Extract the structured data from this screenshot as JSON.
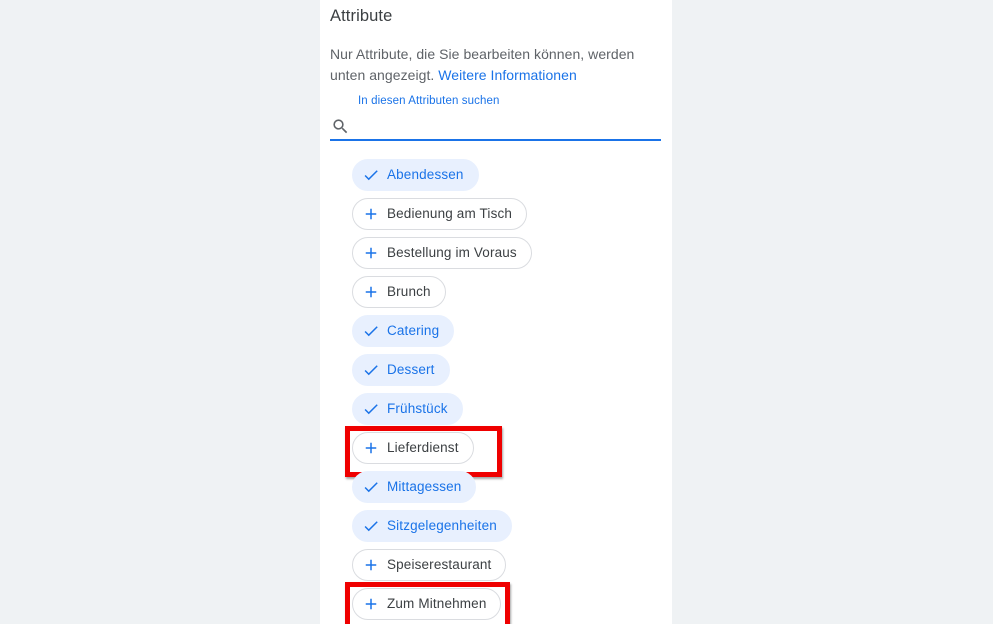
{
  "panel": {
    "title": "Attribute",
    "description_before_link": "Nur Attribute, die Sie bearbeiten können, werden unten angezeigt. ",
    "description_link": "Weitere Informationen"
  },
  "search": {
    "label": "In diesen Attributen suchen",
    "value": "",
    "placeholder": "",
    "icon": "search-icon"
  },
  "colors": {
    "accent": "#1a73e8",
    "chip_selected_bg": "#e8f0fe",
    "chip_border": "#dadce0",
    "text_primary": "#3c4043",
    "text_secondary": "#5f6368",
    "page_bg": "#eff2f4",
    "panel_bg": "#ffffff",
    "highlight": "#ef0000"
  },
  "chips": [
    {
      "label": "Abendessen",
      "selected": true,
      "icon": "check-icon",
      "highlighted": false
    },
    {
      "label": "Bedienung am Tisch",
      "selected": false,
      "icon": "plus-icon",
      "highlighted": false
    },
    {
      "label": "Bestellung im Voraus",
      "selected": false,
      "icon": "plus-icon",
      "highlighted": false
    },
    {
      "label": "Brunch",
      "selected": false,
      "icon": "plus-icon",
      "highlighted": false
    },
    {
      "label": "Catering",
      "selected": true,
      "icon": "check-icon",
      "highlighted": false
    },
    {
      "label": "Dessert",
      "selected": true,
      "icon": "check-icon",
      "highlighted": false
    },
    {
      "label": "Frühstück",
      "selected": true,
      "icon": "check-icon",
      "highlighted": false
    },
    {
      "label": "Lieferdienst",
      "selected": false,
      "icon": "plus-icon",
      "highlighted": true
    },
    {
      "label": "Mittagessen",
      "selected": true,
      "icon": "check-icon",
      "highlighted": false
    },
    {
      "label": "Sitzgelegenheiten",
      "selected": true,
      "icon": "check-icon",
      "highlighted": false
    },
    {
      "label": "Speiserestaurant",
      "selected": false,
      "icon": "plus-icon",
      "highlighted": false
    },
    {
      "label": "Zum Mitnehmen",
      "selected": false,
      "icon": "plus-icon",
      "highlighted": true
    }
  ]
}
